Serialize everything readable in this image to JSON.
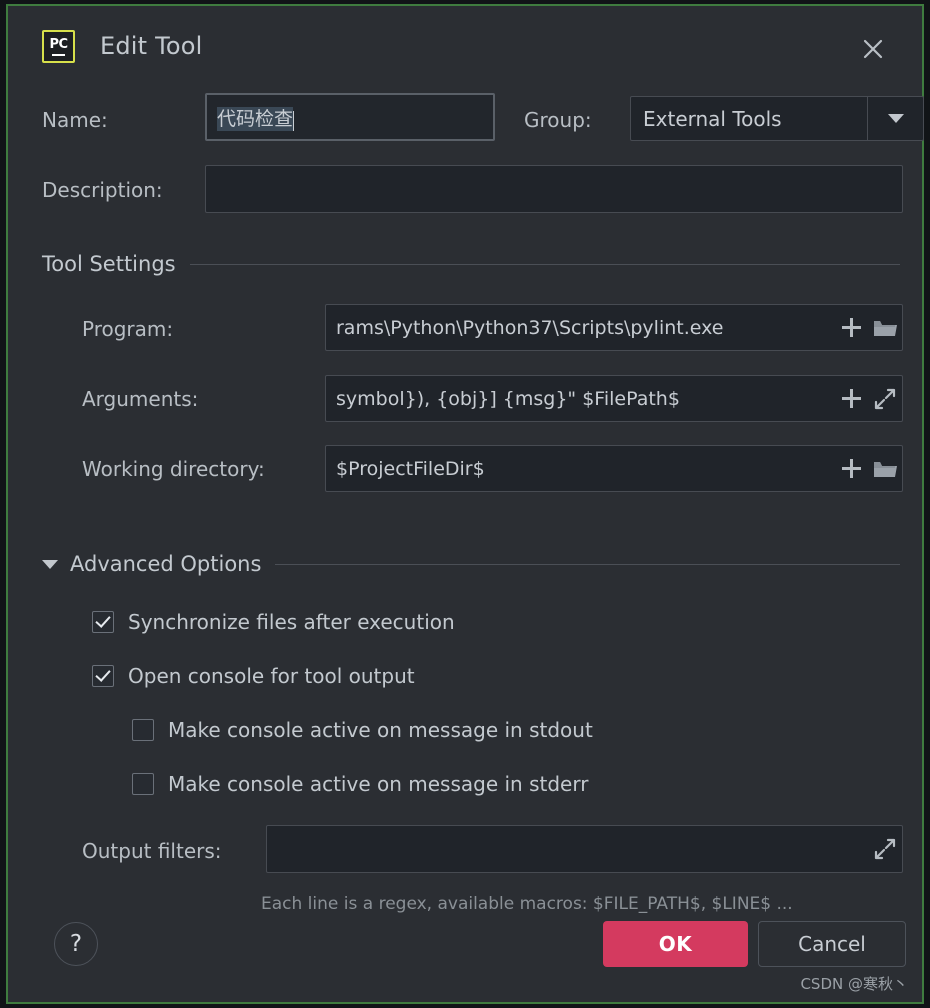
{
  "window": {
    "app_icon": "pycharm-icon",
    "app_icon_text": "PC",
    "title": "Edit Tool",
    "close_icon": "close-icon"
  },
  "form": {
    "name_label": "Name:",
    "name_value": "代码检查",
    "group_label": "Group:",
    "group_value": "External Tools",
    "group_dropdown_icon": "chevron-down-icon",
    "description_label": "Description:",
    "description_value": "",
    "description_placeholder": ""
  },
  "tool_settings": {
    "section_title": "Tool Settings",
    "program_label": "Program:",
    "program_value": "rams\\Python\\Python37\\Scripts\\pylint.exe",
    "arguments_label": "Arguments:",
    "arguments_value": "symbol}), {obj}] {msg}\" $FilePath$",
    "working_dir_label": "Working directory:",
    "working_dir_value": "$ProjectFileDir$",
    "insert_macro_icon": "plus-icon",
    "browse_icon": "folder-icon",
    "expand_icon": "expand-diagonal-icon"
  },
  "advanced": {
    "section_title": "Advanced Options",
    "collapse_icon": "triangle-down-icon",
    "checkboxes": [
      {
        "label": "Synchronize files after execution",
        "checked": true,
        "indent": 0
      },
      {
        "label": "Open console for tool output",
        "checked": true,
        "indent": 0
      },
      {
        "label": "Make console active on message in stdout",
        "checked": false,
        "indent": 1
      },
      {
        "label": "Make console active on message in stderr",
        "checked": false,
        "indent": 1
      }
    ],
    "output_filters_label": "Output filters:",
    "output_filters_value": "",
    "output_filters_expand_icon": "expand-diagonal-icon",
    "hint": "Each line is a regex, available macros: $FILE_PATH$, $LINE$ ..."
  },
  "footer": {
    "help_label": "?",
    "ok_label": "OK",
    "cancel_label": "Cancel",
    "watermark": "CSDN @寒秋丶"
  },
  "colors": {
    "dialog_background": "#2b2e33",
    "field_background": "#20242a",
    "accent_ok": "#d43a5f",
    "annotation_border": "#3f7c3f",
    "icon_border": "#d7e04b",
    "text_primary": "#c3c9cf",
    "text_muted": "#8a9096"
  }
}
